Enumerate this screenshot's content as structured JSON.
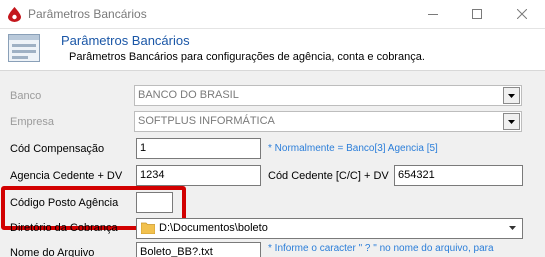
{
  "window": {
    "title": "Parâmetros Bancários"
  },
  "header": {
    "title": "Parâmetros Bancários",
    "subtitle": "Parâmetros Bancários para configurações de agência, conta e cobrança."
  },
  "form": {
    "banco": {
      "label": "Banco",
      "value": "BANCO DO BRASIL"
    },
    "empresa": {
      "label": "Empresa",
      "value": "SOFTPLUS INFORMÁTICA"
    },
    "cod_compensacao": {
      "label": "Cód Compensação",
      "value": "1",
      "hint": "* Normalmente  = Banco[3] Agencia [5]"
    },
    "agencia_cedente": {
      "label": "Agencia Cedente + DV",
      "value": "1234"
    },
    "cod_cedente": {
      "label": "Cód Cedente [C/C] + DV",
      "value": "654321"
    },
    "codigo_posto": {
      "label": "Código Posto Agência",
      "value": ""
    },
    "diretorio": {
      "label": "Diretório da Cobrança",
      "value": "D:\\Documentos\\boleto"
    },
    "nome_arquivo": {
      "label": "Nome do Arquivo",
      "value": "Boleto_BB?.txt",
      "hint": "* Informe o caracter \" ? \" no nome do arquivo, para"
    }
  },
  "colors": {
    "header_title": "#1b57a7",
    "hint": "#2b7ed9",
    "highlight": "#d20000"
  }
}
